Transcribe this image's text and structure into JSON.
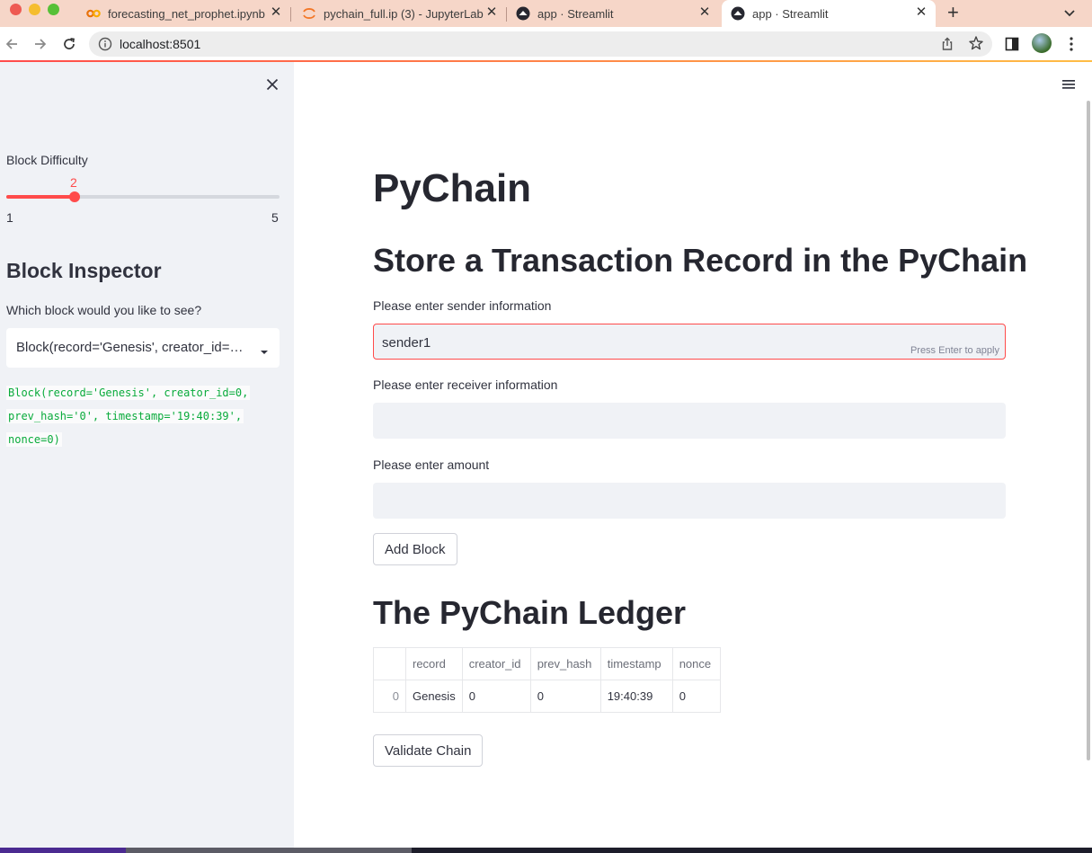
{
  "browser": {
    "tabs": [
      {
        "title": "forecasting_net_prophet.ipynb",
        "icon": "colab-icon",
        "active": false
      },
      {
        "title": "pychain_full.ip (3) - JupyterLab",
        "icon": "jupyter-icon",
        "active": false
      },
      {
        "title": "app · Streamlit",
        "icon": "streamlit-icon",
        "active": false
      },
      {
        "title": "app · Streamlit",
        "icon": "streamlit-icon",
        "active": true
      }
    ],
    "url": "localhost:8501"
  },
  "sidebar": {
    "difficulty_label": "Block Difficulty",
    "difficulty": {
      "value": 2,
      "min": 1,
      "max": 5,
      "value_text": "2",
      "min_text": "1",
      "max_text": "5"
    },
    "inspector_header": "Block Inspector",
    "select_label": "Which block would you like to see?",
    "select_value": "Block(record='Genesis', creator_id=0, prev_hash='0', timestamp='19:40:39', nonce=0)",
    "code_lines": [
      "Block(record='Genesis', creator_id=0,",
      "prev_hash='0', timestamp='19:40:39',",
      "nonce=0)"
    ]
  },
  "main": {
    "title": "PyChain",
    "form_header": "Store a Transaction Record in the PyChain",
    "sender": {
      "label": "Please enter sender information",
      "value": "sender1",
      "hint": "Press Enter to apply"
    },
    "receiver": {
      "label": "Please enter receiver information",
      "value": ""
    },
    "amount": {
      "label": "Please enter amount",
      "value": ""
    },
    "add_block_label": "Add Block",
    "ledger_header": "The PyChain Ledger",
    "ledger": {
      "columns": [
        "record",
        "creator_id",
        "prev_hash",
        "timestamp",
        "nonce"
      ],
      "rows": [
        {
          "index": "0",
          "cells": [
            "Genesis",
            "0",
            "0",
            "19:40:39",
            "0"
          ]
        }
      ]
    },
    "validate_label": "Validate Chain"
  },
  "colors": {
    "accent": "#ff4b4b",
    "sidebar_bg": "#f0f2f6",
    "code_green": "#09ab3b"
  }
}
